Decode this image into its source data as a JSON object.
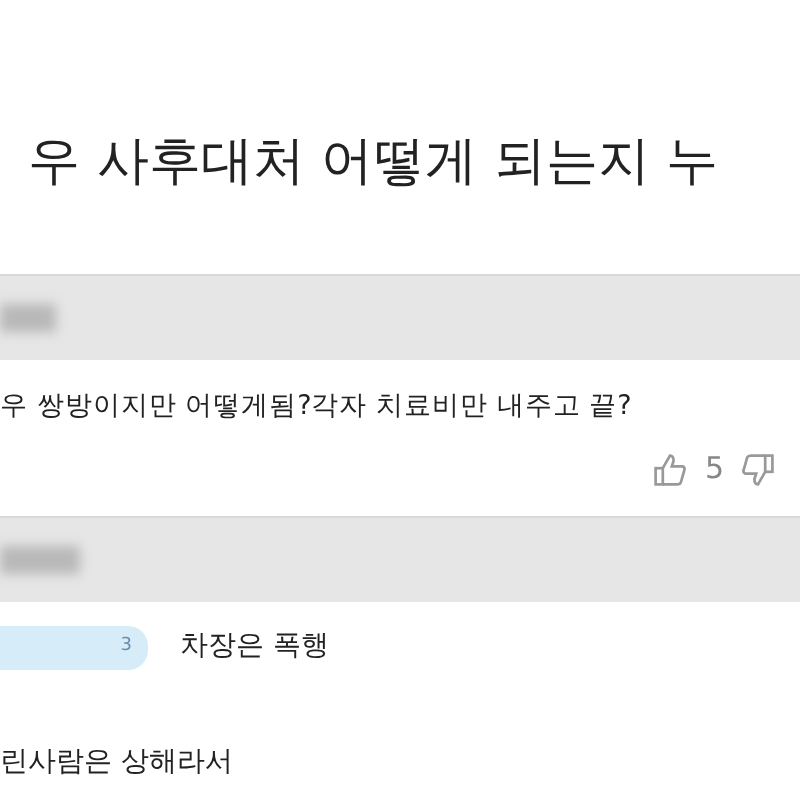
{
  "post": {
    "title": "우 사후대처 어떻게 되는지 누"
  },
  "comments": [
    {
      "kind": "comment",
      "text": "우 쌍방이지만 어떻게됨?각자 치료비만 내주고 끝?",
      "likes": "5"
    },
    {
      "kind": "reply",
      "badge": "3",
      "text": "차장은 폭행"
    }
  ],
  "trailing_text": "린사람은 상해라서"
}
